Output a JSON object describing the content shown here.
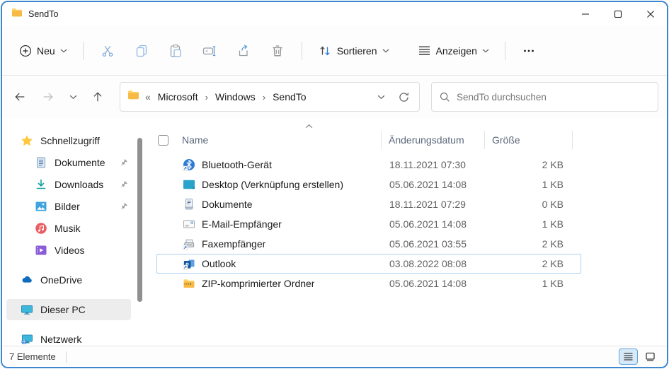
{
  "window": {
    "title": "SendTo"
  },
  "icons": {
    "titlebar": "folder-icon",
    "window_controls": [
      "minimize-icon",
      "maximize-icon",
      "close-icon"
    ],
    "toolbar": [
      "plus-circle-icon",
      "chevron-down-icon",
      "cut-icon",
      "copy-icon",
      "paste-icon",
      "rename-icon",
      "share-icon",
      "delete-icon",
      "sort-icon",
      "view-list-icon",
      "more-ellipsis-icon"
    ],
    "navigation": [
      "arrow-left-icon",
      "arrow-right-icon",
      "chevron-down-icon",
      "arrow-up-icon",
      "refresh-icon",
      "search-icon"
    ]
  },
  "toolbar": {
    "new_label": "Neu",
    "sort_label": "Sortieren",
    "view_label": "Anzeigen"
  },
  "address": {
    "crumb_prefix": "«",
    "crumbs": [
      "Microsoft",
      "Windows",
      "SendTo"
    ],
    "crumb_separator": "›",
    "search_placeholder": "SendTo durchsuchen"
  },
  "sidebar": {
    "items": [
      {
        "label": "Schnellzugriff",
        "icon": "star-icon",
        "pinned": false
      },
      {
        "label": "Dokumente",
        "icon": "documents-icon",
        "pinned": true
      },
      {
        "label": "Downloads",
        "icon": "download-icon",
        "pinned": true
      },
      {
        "label": "Bilder",
        "icon": "pictures-icon",
        "pinned": true
      },
      {
        "label": "Musik",
        "icon": "music-icon",
        "pinned": false
      },
      {
        "label": "Videos",
        "icon": "videos-icon",
        "pinned": false
      },
      {
        "label": "OneDrive",
        "icon": "onedrive-icon",
        "pinned": false
      },
      {
        "label": "Dieser PC",
        "icon": "this-pc-icon",
        "pinned": false,
        "selected": true
      },
      {
        "label": "Netzwerk",
        "icon": "network-icon",
        "pinned": false
      }
    ]
  },
  "columns": {
    "name": "Name",
    "date": "Änderungsdatum",
    "size": "Größe"
  },
  "files": [
    {
      "name": "Bluetooth-Gerät",
      "date": "18.11.2021 07:30",
      "size": "2 KB",
      "icon": "bluetooth-icon",
      "selected": false
    },
    {
      "name": "Desktop (Verknüpfung erstellen)",
      "date": "05.06.2021 14:08",
      "size": "1 KB",
      "icon": "desktop-icon",
      "selected": false
    },
    {
      "name": "Dokumente",
      "date": "18.11.2021 07:29",
      "size": "0 KB",
      "icon": "document-icon",
      "selected": false
    },
    {
      "name": "E-Mail-Empfänger",
      "date": "05.06.2021 14:08",
      "size": "1 KB",
      "icon": "mail-icon",
      "selected": false
    },
    {
      "name": "Faxempfänger",
      "date": "05.06.2021 03:55",
      "size": "2 KB",
      "icon": "fax-icon",
      "selected": false
    },
    {
      "name": "Outlook",
      "date": "03.08.2022 08:08",
      "size": "2 KB",
      "icon": "outlook-icon",
      "selected": true
    },
    {
      "name": "ZIP-komprimierter Ordner",
      "date": "05.06.2021 14:08",
      "size": "1 KB",
      "icon": "zip-folder-icon",
      "selected": false
    }
  ],
  "statusbar": {
    "count": "7 Elemente"
  },
  "colors": {
    "window_border": "#3d87d0",
    "accent_blue": "#2f7cd6",
    "selection_outline": "#a9d1f0",
    "sidebar_selected_bg": "#ededed",
    "folder_yellow": "#fcbd43"
  }
}
